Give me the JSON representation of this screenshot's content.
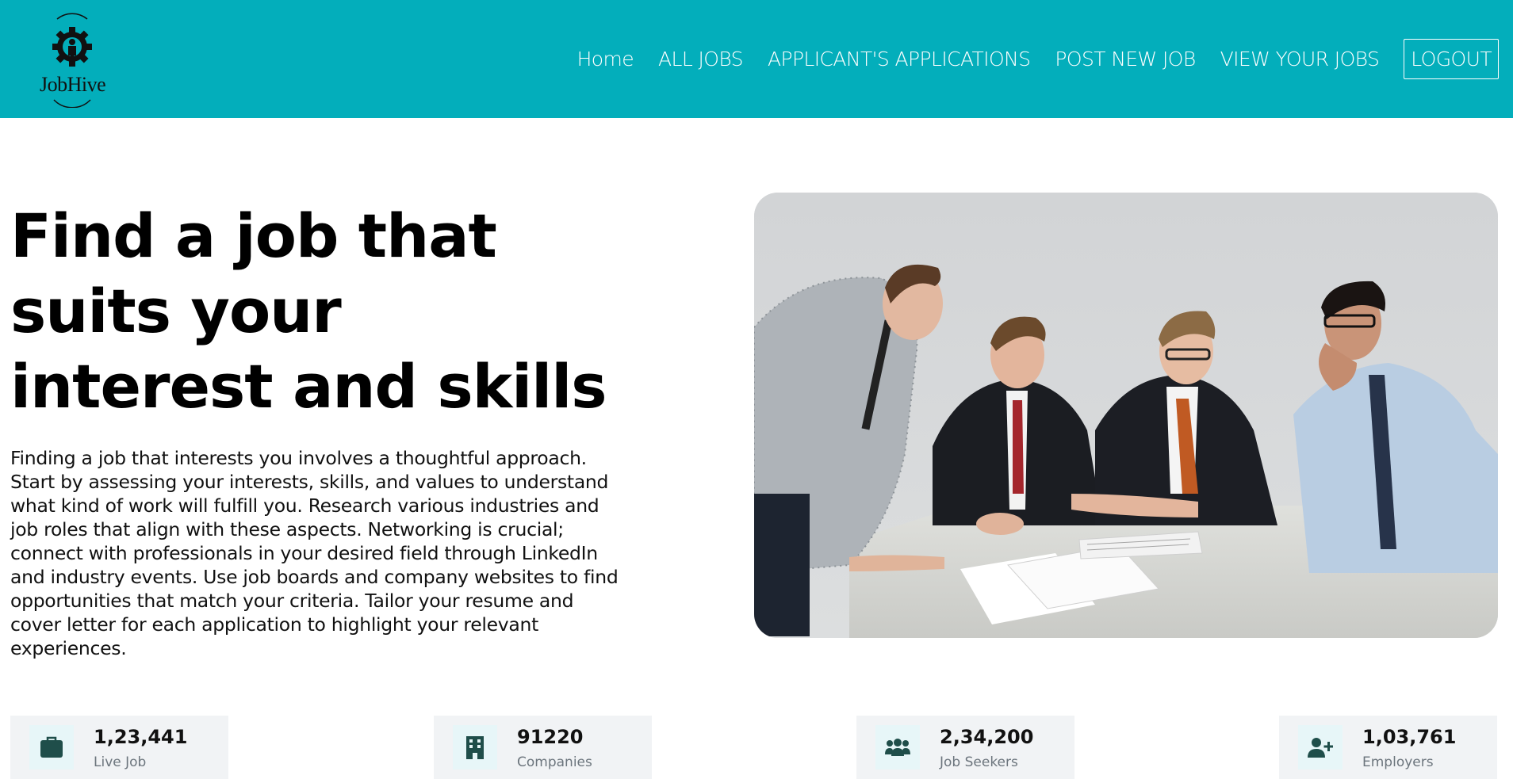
{
  "brand": {
    "name": "JobHive"
  },
  "nav": {
    "items": [
      {
        "label": "Home"
      },
      {
        "label": "ALL JOBS"
      },
      {
        "label": "APPLICANT'S APPLICATIONS"
      },
      {
        "label": "POST NEW JOB"
      },
      {
        "label": "VIEW YOUR JOBS"
      },
      {
        "label": "LOGOUT"
      }
    ]
  },
  "hero": {
    "title": "Find a job that suits your interest and skills",
    "description": "Finding a job that interests you involves a thoughtful approach. Start by assessing your interests, skills, and values to understand what kind of work will fulfill you. Research various industries and job roles that align with these aspects. Networking is crucial; connect with professionals in your desired field through LinkedIn and industry events. Use job boards and company websites to find opportunities that match your criteria. Tailor your resume and cover letter for each application to highlight your relevant experiences.",
    "image_icon": "team-meeting-photo"
  },
  "stats": [
    {
      "value": "1,23,441",
      "label": "Live Job",
      "icon": "briefcase-icon"
    },
    {
      "value": "91220",
      "label": "Companies",
      "icon": "building-icon"
    },
    {
      "value": "2,34,200",
      "label": "Job Seekers",
      "icon": "users-icon"
    },
    {
      "value": "1,03,761",
      "label": "Employers",
      "icon": "user-plus-icon"
    }
  ],
  "colors": {
    "navbar": "#03aebb",
    "nav_text": "#ffffff",
    "stat_card_bg": "#f1f3f5",
    "stat_icon_bg": "#e7f6f8",
    "stat_icon_color": "#1f4e4a"
  }
}
